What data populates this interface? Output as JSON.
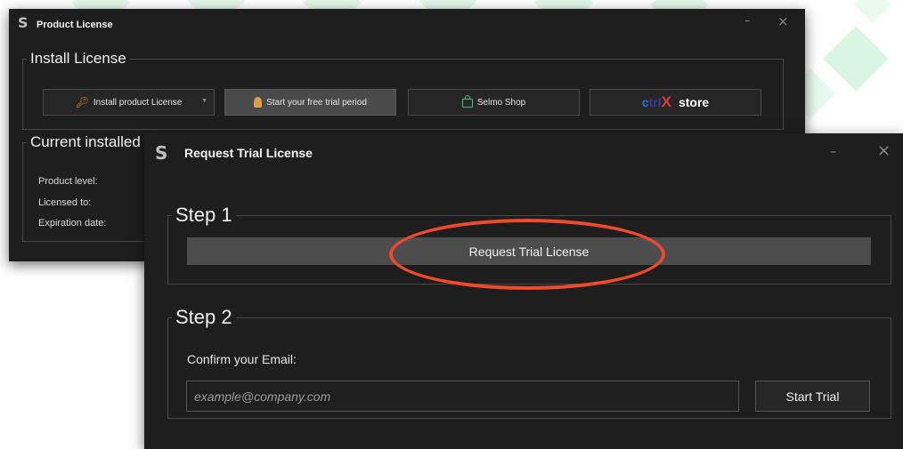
{
  "background": {
    "decoration": "green-diamond-pattern",
    "accent": "#dff7e6"
  },
  "product_license_window": {
    "title": "Product License",
    "logo": "S",
    "controls": {
      "minimize": "–",
      "close": "×"
    },
    "install_group": {
      "title": "Install License",
      "install_button": {
        "label": "Install product License",
        "icon": "key-icon"
      },
      "trial_button": {
        "label": "Start your free trial period",
        "icon": "badge-icon"
      },
      "shop_button": {
        "label": "Selmo Shop",
        "icon": "shopping-bag-icon"
      },
      "store_button": {
        "logo_text": "ctrlX",
        "label": "store"
      }
    },
    "current_group": {
      "title": "Current installed",
      "fields": [
        {
          "label": "Product level:"
        },
        {
          "label": "Licensed to:"
        },
        {
          "label": "Expiration date:"
        }
      ]
    }
  },
  "trial_dialog": {
    "title": "Request Trial License",
    "logo": "S",
    "controls": {
      "minimize": "–",
      "close": "×"
    },
    "step1": {
      "title": "Step 1",
      "button_label": "Request Trial License"
    },
    "step2": {
      "title": "Step 2",
      "confirm_label": "Confirm your Email:",
      "email_placeholder": "example@company.com",
      "email_value": "",
      "start_button": "Start Trial"
    }
  },
  "annotation": {
    "type": "ellipse",
    "color": "#f04a2c",
    "target": "Request Trial License button"
  }
}
